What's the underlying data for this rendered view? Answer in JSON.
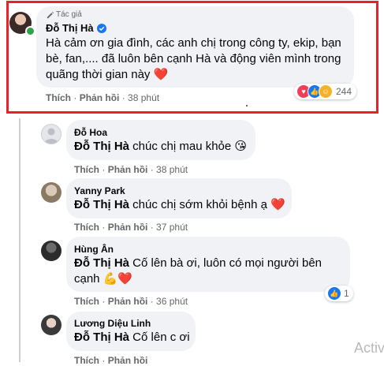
{
  "author_comment": {
    "badge": "Tác giả",
    "name": "Đỗ Thị Hà",
    "text": "Hà cảm ơn gia đình, các anh chị trong công ty, ekip, bạn bè, fan,.... đã luôn bên cạnh Hà và động viên mình trong quãng thời gian này",
    "heart": "❤️",
    "reaction_count": "244",
    "like_label": "Thích",
    "reply_label": "Phản hồi",
    "time": "38 phút"
  },
  "replies": [
    {
      "name": "Đỗ Hoa",
      "mention": "Đỗ Thị Hà",
      "text": "chúc chị mau khỏe",
      "emoji": "😘",
      "like_label": "Thích",
      "reply_label": "Phản hồi",
      "time": "38 phút"
    },
    {
      "name": "Yanny Park",
      "mention": "Đỗ Thị Hà",
      "text": "chúc chị sớm khỏi bệnh ạ",
      "emoji": "❤️",
      "like_label": "Thích",
      "reply_label": "Phản hồi",
      "time": "37 phút"
    },
    {
      "name": "Hùng Ân",
      "mention": "Đỗ Thị Hà",
      "text_line1": "Cố lên bà ơi, luôn có mọi người bên",
      "text_line2": "cạnh",
      "emoji": "💪❤️",
      "like_label": "Thích",
      "reply_label": "Phản hồi",
      "time": "36 phút",
      "like_count": "1"
    },
    {
      "name": "Lương Diệu Linh",
      "mention": "Đỗ Thị Hà",
      "text": "Cố lên c ơi",
      "like_label": "Thích",
      "reply_label": "Phản hồi"
    }
  ],
  "watermark": "Activ",
  "colors": {
    "highlight": "#e8212b",
    "bubble": "#f0f2f5",
    "like_blue": "#1877f2",
    "online": "#31a24c"
  }
}
